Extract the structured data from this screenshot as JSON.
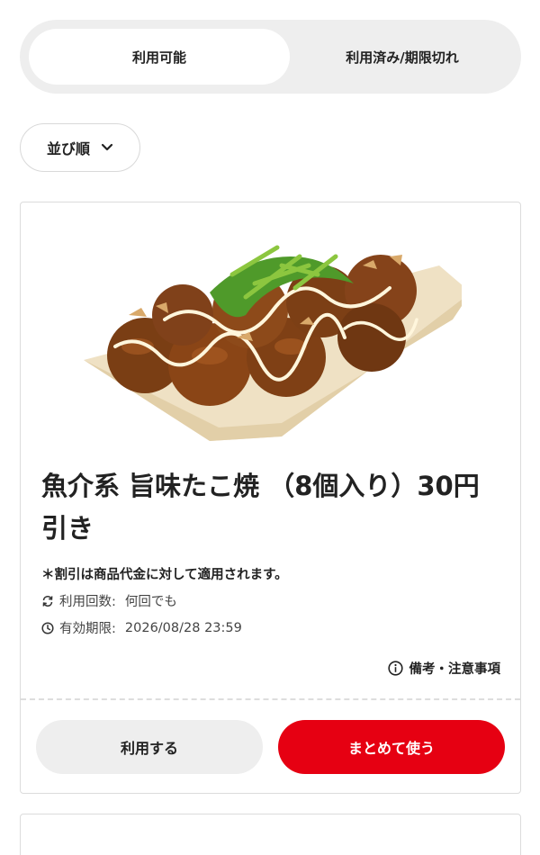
{
  "tabs": {
    "available_label": "利用可能",
    "used_expired_label": "利用済み/期限切れ"
  },
  "sort": {
    "label": "並び順",
    "icon": "chevron-down-icon"
  },
  "coupon": {
    "image": "takoyaki-photo",
    "title": "魚介系 旨味たこ焼 （8個入り）30円引き",
    "note": "＊割引は商品代金に対して適用されます。",
    "usage_label": "利用回数:",
    "usage_value": "何回でも",
    "expiry_label": "有効期限:",
    "expiry_value": "2026/08/28 23:59",
    "remarks_label": "備考・注意事項",
    "use_button_label": "利用する",
    "bulk_button_label": "まとめて使う"
  },
  "colors": {
    "accent": "#e60012",
    "segment_bg": "#eeeeee",
    "secondary_button_bg": "#eeeeee"
  }
}
